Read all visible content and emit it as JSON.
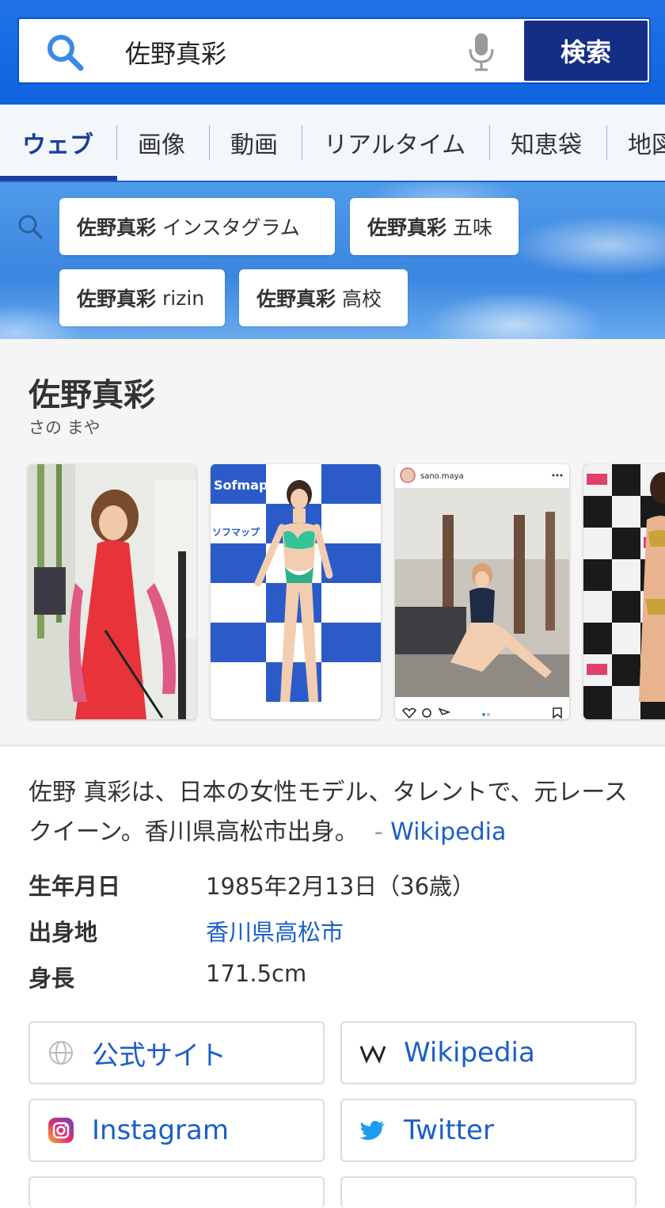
{
  "search": {
    "query": "佐野真彩",
    "button_label": "検索"
  },
  "tabs": [
    "ウェブ",
    "画像",
    "動画",
    "リアルタイム",
    "知恵袋",
    "地図"
  ],
  "suggestions": [
    {
      "bold": "佐野真彩",
      "rest": "インスタグラム"
    },
    {
      "bold": "佐野真彩",
      "rest": "五味"
    },
    {
      "bold": "佐野真彩",
      "rest": "rizin"
    },
    {
      "bold": "佐野真彩",
      "rest": "高校"
    }
  ],
  "knowledge_panel": {
    "title": "佐野真彩",
    "reading": "さの まや",
    "photos": [
      {
        "alt": "red-dress-photo"
      },
      {
        "alt": "sofmap-event-photo",
        "banner_text": "Sofmap",
        "banner_text_jp": "ソフマップ"
      },
      {
        "alt": "instagram-post-photo",
        "username": "sano.maya"
      },
      {
        "alt": "gold-bikini-photo"
      }
    ],
    "description": "佐野 真彩は、日本の女性モデル、タレントで、元レースクイーン。香川県高松市出身。",
    "description_source_prefix": "-",
    "description_source": "Wikipedia",
    "facts": [
      {
        "label": "生年月日",
        "value": "1985年2月13日（36歳）",
        "link": false
      },
      {
        "label": "出身地",
        "value": "香川県高松市",
        "link": true
      },
      {
        "label": "身長",
        "value": "171.5cm",
        "link": false
      }
    ],
    "links": [
      {
        "label": "公式サイト",
        "icon": "globe-icon"
      },
      {
        "label": "Wikipedia",
        "icon": "wikipedia-icon"
      },
      {
        "label": "Instagram",
        "icon": "instagram-icon"
      },
      {
        "label": "Twitter",
        "icon": "twitter-icon"
      }
    ]
  },
  "colors": {
    "header_blue": "#1f72e6",
    "search_button": "#142e86",
    "active_tab": "#1b3e99",
    "link_blue": "#1a5fc8"
  }
}
